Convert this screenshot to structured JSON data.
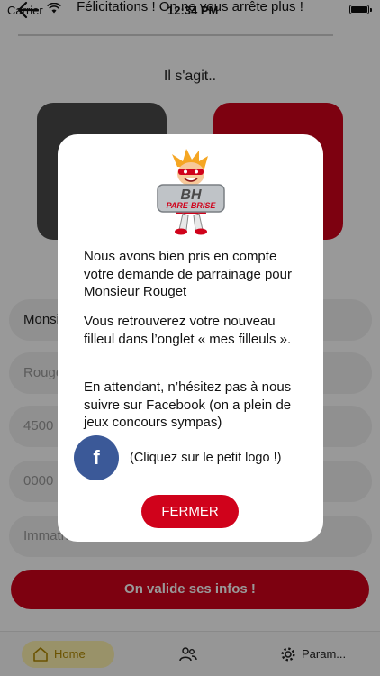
{
  "status_bar": {
    "carrier": "Carrier",
    "time": "12:34 PM"
  },
  "header": {
    "title": "Félicitations ! On ne vous arrête plus !"
  },
  "page": {
    "subtitle": "Il s'agit.."
  },
  "form": {
    "fields": [
      {
        "value": "Monsieur"
      },
      {
        "value": "Rouget"
      },
      {
        "value": "4500"
      },
      {
        "value": "0000"
      },
      {
        "value": "Immatriculation"
      }
    ],
    "submit_label": "On valide ses infos !"
  },
  "tabs": {
    "home_label": "Home",
    "settings_label": "Param..."
  },
  "modal": {
    "logo_text_top": "BH",
    "logo_text_bottom": "PARE-BRISE",
    "message_1": "Nous avons bien pris en compte votre demande de parrainage pour Monsieur Rouget",
    "message_2": "Vous retrouverez votre nouveau filleul dans l’onglet « mes filleuls ».",
    "message_3": "En attendant, n’hésitez pas à nous suivre sur Facebook (on a plein de jeux concours sympas)",
    "facebook_icon_letter": "f",
    "facebook_hint": "(Cliquez sur le petit logo !)",
    "close_label": "FERMER"
  },
  "colors": {
    "accent": "#d0021b",
    "facebook": "#3b5998",
    "home_tab": "#fff3b0"
  }
}
